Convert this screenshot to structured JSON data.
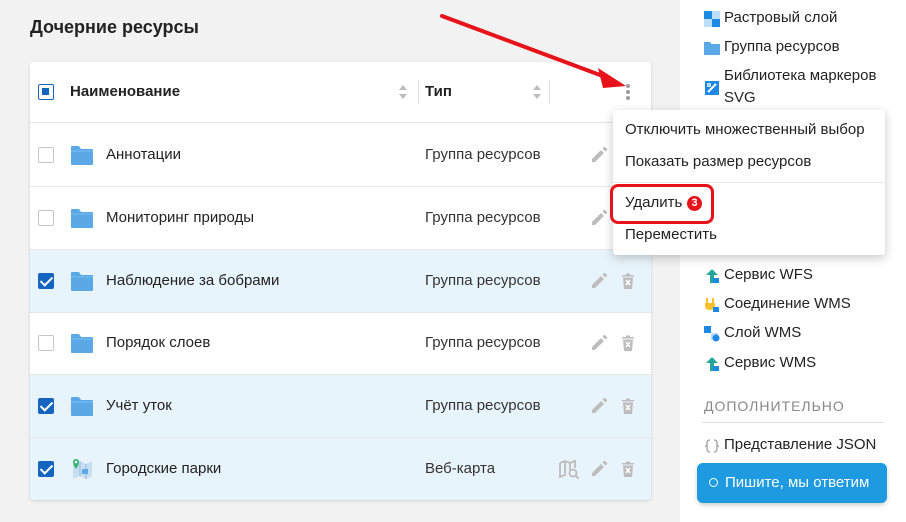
{
  "main": {
    "section_title": "Дочерние ресурсы",
    "columns": {
      "name": "Наименование",
      "type": "Тип"
    },
    "rows": [
      {
        "name": "Аннотации",
        "type": "Группа ресурсов",
        "checked": false,
        "icon": "folder-icon"
      },
      {
        "name": "Мониторинг природы",
        "type": "Группа ресурсов",
        "checked": false,
        "icon": "folder-icon"
      },
      {
        "name": "Наблюдение за бобрами",
        "type": "Группа ресурсов",
        "checked": true,
        "icon": "folder-icon"
      },
      {
        "name": "Порядок слоев",
        "type": "Группа ресурсов",
        "checked": false,
        "icon": "folder-icon"
      },
      {
        "name": "Учёт уток",
        "type": "Группа ресурсов",
        "checked": true,
        "icon": "folder-icon"
      },
      {
        "name": "Городские парки",
        "type": "Веб-карта",
        "checked": true,
        "icon": "webmap-icon"
      }
    ]
  },
  "menu": {
    "items": [
      "Отключить множественный выбор",
      "Показать размер ресурсов",
      "Удалить",
      "Переместить"
    ],
    "delete_badge": "3"
  },
  "sidebar": {
    "items_top": [
      {
        "label": "Растровый слой",
        "icon": "raster-layer-icon"
      },
      {
        "label": "Группа ресурсов",
        "icon": "folder-icon"
      },
      {
        "label": "Библиотека маркеров",
        "label2": "SVG",
        "icon": "svg-marker-library-icon"
      }
    ],
    "items_bottom": [
      {
        "label": "Сервис WFS",
        "icon": "wfs-service-icon"
      },
      {
        "label": "Соединение WMS",
        "icon": "wms-connection-icon"
      },
      {
        "label": "Слой WMS",
        "icon": "wms-layer-icon"
      },
      {
        "label": "Сервис WMS",
        "icon": "wms-service-icon"
      }
    ],
    "heading": "ДОПОЛНИТЕЛЬНО",
    "extra_item": {
      "label": "Представление JSON",
      "icon": "json-braces-icon"
    }
  },
  "chat": {
    "label": "Пишите, мы ответим"
  },
  "colors": {
    "accent": "#1565c0",
    "selected_row": "#e8f4fb",
    "highlight": "#e8121b",
    "chat": "#1e9be0"
  }
}
